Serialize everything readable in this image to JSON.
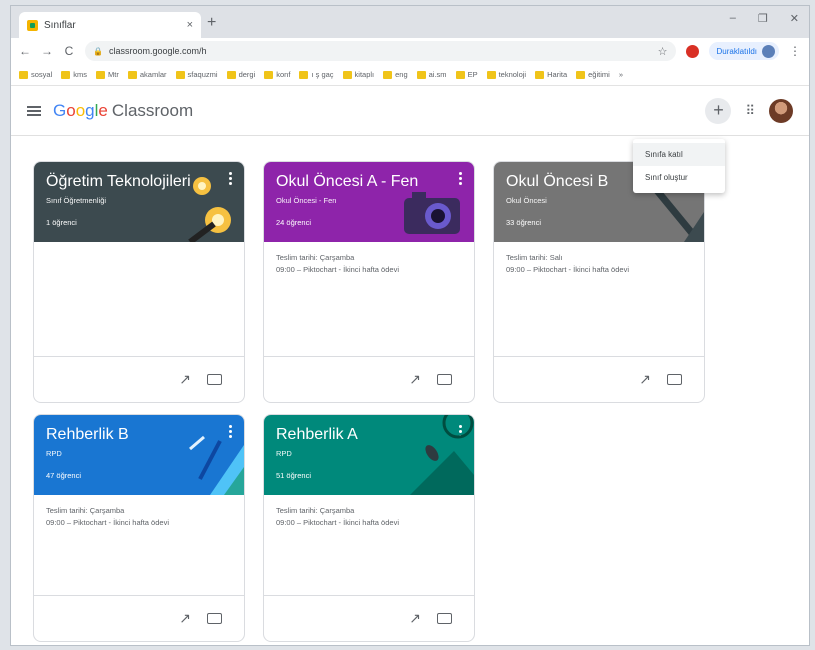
{
  "browser": {
    "tab_title": "Sınıflar",
    "tab_close": "×",
    "new_tab": "+",
    "window_controls": [
      "–",
      "❐",
      "✕"
    ],
    "url": "classroom.google.com/h",
    "profile_label": "Duraklatıldı",
    "nav": {
      "back": "←",
      "forward": "→",
      "reload": "C"
    },
    "bookmarks": [
      "sosyal",
      "kms",
      "Mtr",
      "akamlar",
      "sfaquzmi",
      "dergi",
      "konf",
      "ı ş gaç",
      "kitaplı",
      "eng",
      "ai.sm",
      "EP",
      "teknoloji",
      "Harita",
      "eğitimi"
    ],
    "bookmarks_more": "»"
  },
  "app": {
    "logo_google": [
      "G",
      "o",
      "o",
      "g",
      "l",
      "e"
    ],
    "logo_product": "Classroom",
    "plus": "+",
    "apps": "⋮⋮⋮"
  },
  "menu": {
    "items": [
      "Sınıfa katıl",
      "Sınıf oluştur"
    ]
  },
  "cards": [
    {
      "title": "Öğretim Teknolojileri",
      "section": "Sınıf Öğretmenliği",
      "students": "1 öğrenci",
      "due": "",
      "assignment": "",
      "color": "#3c4a4f"
    },
    {
      "title": "Okul Öncesi A - Fen",
      "section": "Okul Öncesi - Fen",
      "students": "24 öğrenci",
      "due": "Teslim tarihi: Çarşamba",
      "assignment": "09:00 – Piktochart - İkinci hafta ödevi",
      "color": "#8e24aa"
    },
    {
      "title": "Okul Öncesi B",
      "section": "Okul Öncesi",
      "students": "33 öğrenci",
      "due": "Teslim tarihi: Salı",
      "assignment": "09:00 – Piktochart - İkinci hafta ödevi",
      "color": "#757575"
    },
    {
      "title": "Rehberlik B",
      "section": "RPD",
      "students": "47 öğrenci",
      "due": "Teslim tarihi: Çarşamba",
      "assignment": "09:00 – Piktochart - İkinci hafta ödevi",
      "color": "#1976d2"
    },
    {
      "title": "Rehberlik A",
      "section": "RPD",
      "students": "51 öğrenci",
      "due": "Teslim tarihi: Çarşamba",
      "assignment": "09:00 – Piktochart - İkinci hafta ödevi",
      "color": "#00897b"
    }
  ],
  "card_actions": {
    "trend_glyph": "↗"
  }
}
